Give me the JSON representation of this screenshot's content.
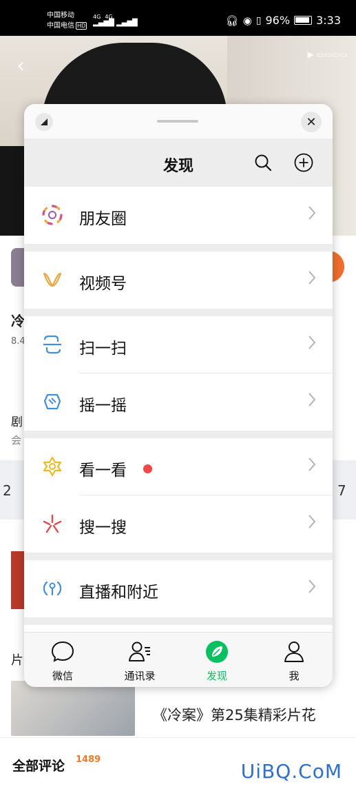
{
  "status_bar": {
    "carrier_1": "中国移动",
    "carrier_2": "中国电信",
    "hd_badge": "HD",
    "signal_1": "4G",
    "signal_2": "4G",
    "battery": "96%",
    "time": "3:33"
  },
  "background_page": {
    "video_title": "《冷案》第25集精彩片花",
    "comments_label": "全部评论",
    "comments_count": "1489",
    "watermark": "UiBQ.CoM",
    "side_texts": {
      "t1": "冷",
      "t2": "8.4",
      "t3": "剧",
      "t4": "会",
      "t5": "2",
      "t6": "7",
      "t7": "片"
    }
  },
  "window": {
    "title": "发现",
    "menu": [
      {
        "id": "moments",
        "label": "朋友圈",
        "icon": "moments-icon"
      },
      {
        "id": "channels",
        "label": "视频号",
        "icon": "channels-icon"
      },
      {
        "id": "scan",
        "label": "扫一扫",
        "icon": "scan-icon"
      },
      {
        "id": "shake",
        "label": "摇一摇",
        "icon": "shake-icon"
      },
      {
        "id": "top-stories",
        "label": "看一看",
        "icon": "top-stories-icon",
        "badge": "red-dot"
      },
      {
        "id": "search",
        "label": "搜一搜",
        "icon": "search-feature-icon"
      },
      {
        "id": "live-nearby",
        "label": "直播和附近",
        "icon": "live-nearby-icon"
      }
    ],
    "tabs": [
      {
        "id": "chats",
        "label": "微信",
        "icon": "chat-bubble-icon"
      },
      {
        "id": "contacts",
        "label": "通讯录",
        "icon": "contacts-icon"
      },
      {
        "id": "discover",
        "label": "发现",
        "icon": "compass-icon",
        "active": true
      },
      {
        "id": "me",
        "label": "我",
        "icon": "person-icon"
      }
    ],
    "colors": {
      "accent": "#07c160",
      "nav_bg": "#ededed",
      "badge": "#f04848"
    }
  }
}
